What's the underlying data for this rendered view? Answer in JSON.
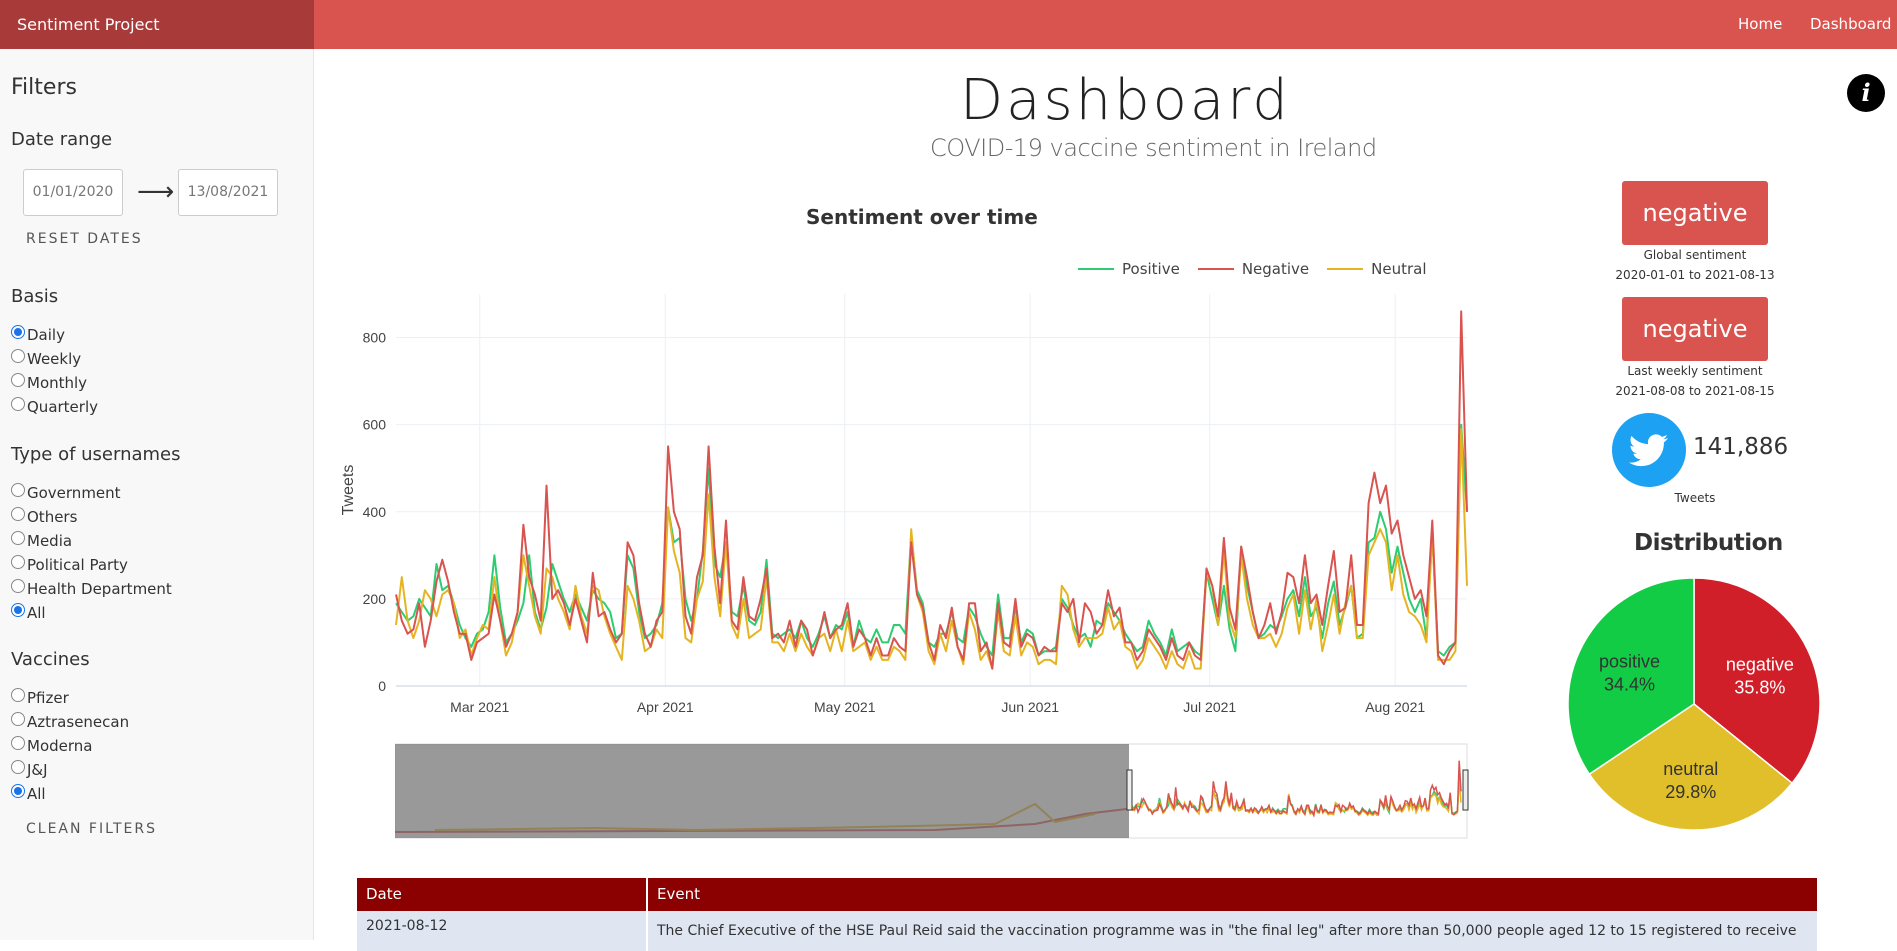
{
  "navbar": {
    "brand": "Sentiment Project",
    "links": [
      "Home",
      "Dashboard"
    ]
  },
  "sidebar": {
    "title": "Filters",
    "date_range": {
      "heading": "Date range",
      "from": "01/01/2020",
      "to": "13/08/2021",
      "reset_label": "RESET DATES"
    },
    "basis": {
      "heading": "Basis",
      "options": [
        "Daily",
        "Weekly",
        "Monthly",
        "Quarterly"
      ],
      "selected": "Daily"
    },
    "usernames": {
      "heading": "Type of usernames",
      "options": [
        "Government",
        "Others",
        "Media",
        "Political Party",
        "Health Department",
        "All"
      ],
      "selected": "All"
    },
    "vaccines": {
      "heading": "Vaccines",
      "options": [
        "Pfizer",
        "Aztrasenecan",
        "Moderna",
        "J&J",
        "All"
      ],
      "selected": "All"
    },
    "clean_label": "CLEAN FILTERS"
  },
  "main": {
    "title": "Dashboard",
    "subtitle": "COVID-19 vaccine sentiment in Ireland"
  },
  "right": {
    "global": {
      "label": "negative",
      "caption": "Global sentiment",
      "range": "2020-01-01 to 2021-08-13"
    },
    "weekly": {
      "label": "negative",
      "caption": "Last weekly sentiment",
      "range": "2021-08-08 to 2021-08-15"
    },
    "tweets": {
      "count": "141,886",
      "label": "Tweets",
      "icon": "twitter-icon"
    },
    "distribution_title": "Distribution"
  },
  "table": {
    "headers": {
      "date": "Date",
      "event": "Event"
    },
    "rows": [
      {
        "date": "2021-08-12",
        "event": "The Chief Executive of the HSE Paul Reid said the vaccination programme was in \"the final leg\" after more than 50,000 people aged 12 to 15 registered to receive"
      }
    ]
  },
  "colors": {
    "navbar": "#d9534f",
    "brand": "#a83a3a",
    "positive": "#2ecc71",
    "negative": "#d9534f",
    "neutral": "#e6b422",
    "table_header": "#8b0000"
  },
  "chart_data": [
    {
      "type": "line",
      "title": "Sentiment over time",
      "ylabel": "Tweets",
      "ylim": [
        0,
        900
      ],
      "yticks": [
        0,
        200,
        400,
        600,
        800
      ],
      "xticks": [
        "Mar 2021",
        "Apr 2021",
        "May 2021",
        "Jun 2021",
        "Jul 2021",
        "Aug 2021"
      ],
      "x_start": "2021-02-15",
      "x_end": "2021-08-13",
      "legend": "top-right",
      "series": [
        {
          "name": "Positive",
          "color": "#2ecc71",
          "values": [
            190,
            170,
            150,
            160,
            200,
            180,
            160,
            280,
            220,
            230,
            190,
            140,
            110,
            90,
            120,
            130,
            170,
            300,
            180,
            100,
            120,
            150,
            190,
            300,
            170,
            130,
            180,
            280,
            240,
            200,
            170,
            210,
            180,
            150,
            220,
            200,
            190,
            170,
            110,
            120,
            300,
            270,
            170,
            110,
            120,
            140,
            190,
            410,
            330,
            340,
            200,
            150,
            200,
            310,
            500,
            280,
            250,
            330,
            170,
            160,
            230,
            150,
            140,
            170,
            290,
            120,
            110,
            120,
            130,
            110,
            150,
            110,
            90,
            120,
            160,
            110,
            140,
            130,
            170,
            90,
            150,
            110,
            100,
            130,
            100,
            100,
            140,
            140,
            120,
            350,
            220,
            190,
            100,
            90,
            120,
            120,
            170,
            110,
            100,
            180,
            160,
            120,
            90,
            70,
            210,
            110,
            110,
            180,
            100,
            130,
            120,
            70,
            80,
            80,
            90,
            200,
            180,
            140,
            110,
            120,
            90,
            150,
            140,
            190,
            170,
            150,
            120,
            100,
            80,
            90,
            150,
            120,
            100,
            70,
            130,
            80,
            90,
            100,
            80,
            70,
            260,
            200,
            140,
            230,
            130,
            80,
            320,
            230,
            170,
            110,
            120,
            140,
            130,
            160,
            200,
            220,
            160,
            250,
            160,
            180,
            110,
            190,
            240,
            140,
            180,
            230,
            110,
            120,
            330,
            340,
            400,
            360,
            260,
            320,
            260,
            200,
            170,
            200,
            110,
            350,
            80,
            70,
            90,
            100,
            600,
            400
          ]
        },
        {
          "name": "Negative",
          "color": "#d9534f",
          "values": [
            210,
            150,
            120,
            130,
            190,
            90,
            150,
            240,
            290,
            240,
            170,
            120,
            120,
            60,
            100,
            110,
            120,
            210,
            150,
            90,
            120,
            170,
            370,
            250,
            210,
            150,
            460,
            200,
            220,
            190,
            140,
            200,
            150,
            100,
            260,
            160,
            170,
            130,
            100,
            120,
            330,
            300,
            190,
            120,
            90,
            150,
            170,
            550,
            400,
            360,
            160,
            120,
            250,
            300,
            550,
            320,
            190,
            380,
            150,
            130,
            250,
            160,
            150,
            200,
            270,
            110,
            120,
            100,
            150,
            90,
            150,
            130,
            70,
            110,
            170,
            110,
            130,
            140,
            190,
            90,
            130,
            110,
            70,
            110,
            70,
            70,
            110,
            90,
            80,
            330,
            210,
            180,
            100,
            60,
            140,
            110,
            180,
            90,
            60,
            190,
            190,
            80,
            100,
            40,
            190,
            100,
            90,
            200,
            90,
            120,
            110,
            70,
            90,
            80,
            80,
            190,
            170,
            200,
            100,
            190,
            170,
            120,
            140,
            220,
            160,
            180,
            100,
            100,
            60,
            80,
            130,
            110,
            90,
            60,
            110,
            70,
            60,
            100,
            70,
            60,
            270,
            230,
            160,
            340,
            180,
            130,
            320,
            250,
            170,
            110,
            140,
            190,
            120,
            170,
            260,
            250,
            190,
            300,
            190,
            210,
            140,
            230,
            310,
            170,
            180,
            300,
            140,
            140,
            420,
            490,
            420,
            460,
            350,
            380,
            300,
            250,
            200,
            220,
            160,
            380,
            70,
            50,
            80,
            100,
            860,
            400
          ]
        },
        {
          "name": "Neutral",
          "color": "#e6b422",
          "values": [
            140,
            250,
            150,
            110,
            150,
            220,
            200,
            160,
            210,
            220,
            190,
            110,
            130,
            70,
            110,
            140,
            130,
            250,
            150,
            70,
            100,
            170,
            300,
            230,
            160,
            120,
            270,
            250,
            200,
            170,
            130,
            230,
            160,
            120,
            230,
            220,
            160,
            120,
            90,
            60,
            230,
            200,
            150,
            80,
            90,
            130,
            110,
            410,
            310,
            260,
            110,
            100,
            200,
            240,
            440,
            250,
            160,
            330,
            140,
            110,
            200,
            110,
            120,
            130,
            250,
            100,
            100,
            80,
            120,
            80,
            120,
            90,
            70,
            110,
            120,
            80,
            130,
            80,
            150,
            80,
            90,
            100,
            60,
            90,
            60,
            60,
            90,
            80,
            60,
            360,
            210,
            170,
            80,
            50,
            120,
            80,
            150,
            90,
            50,
            170,
            130,
            60,
            80,
            40,
            170,
            80,
            70,
            160,
            70,
            100,
            90,
            50,
            60,
            60,
            50,
            230,
            210,
            130,
            90,
            110,
            110,
            110,
            120,
            180,
            130,
            150,
            90,
            80,
            40,
            60,
            110,
            90,
            70,
            40,
            80,
            50,
            40,
            80,
            40,
            40,
            260,
            230,
            140,
            310,
            150,
            110,
            300,
            200,
            140,
            110,
            110,
            120,
            90,
            120,
            180,
            210,
            120,
            220,
            130,
            200,
            80,
            140,
            210,
            120,
            190,
            230,
            110,
            110,
            300,
            330,
            360,
            330,
            220,
            300,
            210,
            170,
            160,
            140,
            100,
            350,
            60,
            60,
            60,
            80,
            590,
            230
          ]
        }
      ]
    },
    {
      "type": "pie",
      "title": "Distribution",
      "labels": [
        "negative",
        "neutral",
        "positive"
      ],
      "values": [
        35.8,
        29.8,
        34.4
      ],
      "colors": [
        "#d11f2a",
        "#e0bf2a",
        "#11cc44"
      ]
    }
  ]
}
